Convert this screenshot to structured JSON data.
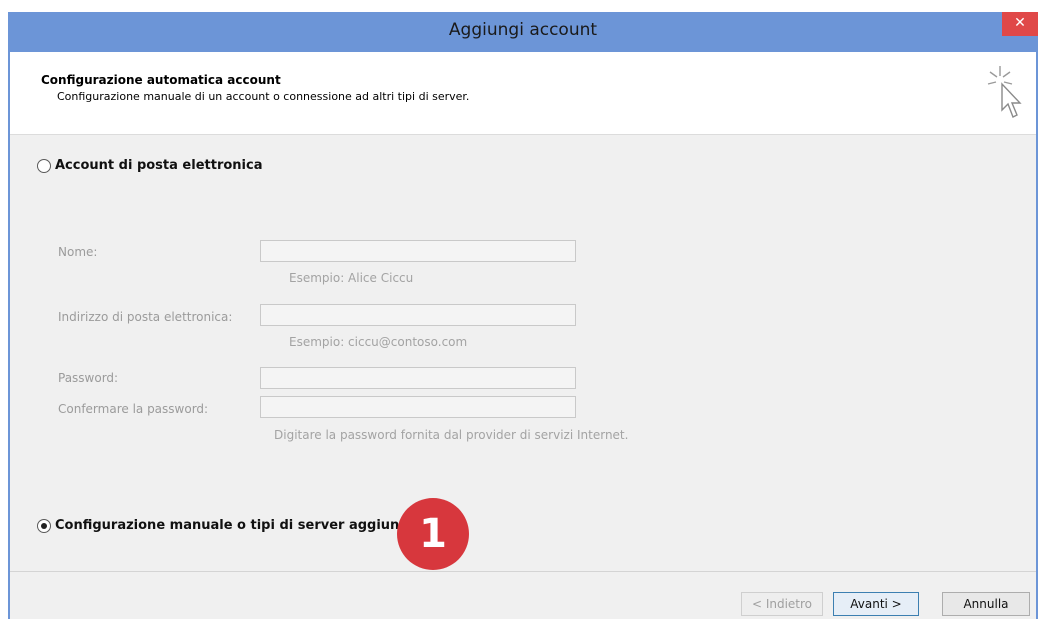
{
  "window": {
    "title": "Aggiungi account",
    "close_glyph": "✕"
  },
  "header": {
    "title": "Configurazione automatica account",
    "subtitle": "Configurazione manuale di un account o connessione ad altri tipi di server."
  },
  "options": {
    "email_account": "Account di posta elettronica",
    "manual_setup": "Configurazione manuale o tipi di server aggiuntivi"
  },
  "form": {
    "name_label": "Nome:",
    "name_hint": "Esempio: Alice Ciccu",
    "email_label": "Indirizzo di posta elettronica:",
    "email_hint": "Esempio: ciccu@contoso.com",
    "password_label": "Password:",
    "confirm_label": "Confermare la password:",
    "password_hint": "Digitare la password fornita dal provider di servizi Internet."
  },
  "callout": {
    "number": "1"
  },
  "buttons": {
    "back": "< Indietro",
    "next": "Avanti >",
    "cancel": "Annulla"
  },
  "colors": {
    "titlebar": "#6c95d7",
    "close": "#e04848",
    "callout": "#d7373d"
  }
}
